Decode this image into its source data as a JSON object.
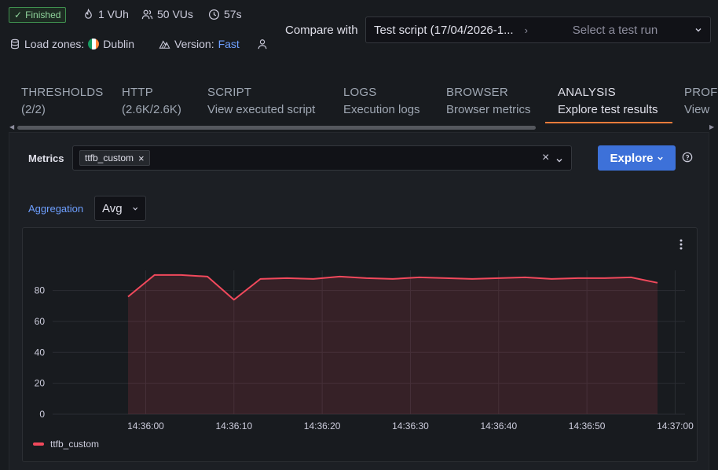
{
  "header": {
    "status_badge": "Finished",
    "vuh": "1 VUh",
    "vus": "50 VUs",
    "duration": "57s",
    "load_zones_label": "Load zones:",
    "load_zone": "Dublin",
    "version_label": "Version:",
    "version_value": "Fast",
    "compare_label": "Compare with",
    "compare_value": "Test script (17/04/2026-1...",
    "compare_placeholder": "Select a test run"
  },
  "tabs": [
    {
      "label": "THRESHOLDS",
      "sub": "(2/2)"
    },
    {
      "label": "HTTP",
      "sub": "(2.6K/2.6K)"
    },
    {
      "label": "SCRIPT",
      "sub": "View executed script"
    },
    {
      "label": "LOGS",
      "sub": "Execution logs"
    },
    {
      "label": "BROWSER",
      "sub": "Browser metrics"
    },
    {
      "label": "ANALYSIS",
      "sub": "Explore test results"
    },
    {
      "label": "PROF",
      "sub": "View"
    }
  ],
  "explore": {
    "metrics_label": "Metrics",
    "metric_chip": "ttfb_custom",
    "explore_button": "Explore",
    "aggregation_label": "Aggregation",
    "aggregation_value": "Avg"
  },
  "colors": {
    "accent": "#3d71d9",
    "series": "#f2495c",
    "tab_active": "#f17c3b",
    "finished": "#8fd39b"
  },
  "chart_data": {
    "type": "area",
    "x": [
      "14:35:58",
      "14:36:01",
      "14:36:04",
      "14:36:07",
      "14:36:10",
      "14:36:13",
      "14:36:16",
      "14:36:19",
      "14:36:22",
      "14:36:25",
      "14:36:28",
      "14:36:31",
      "14:36:34",
      "14:36:37",
      "14:36:40",
      "14:36:43",
      "14:36:46",
      "14:36:49",
      "14:36:52",
      "14:36:55",
      "14:36:58"
    ],
    "series": [
      {
        "name": "ttfb_custom",
        "values": [
          76,
          90,
          90,
          89,
          74,
          87.5,
          88,
          87.5,
          89,
          88,
          87.5,
          88.5,
          88,
          87.5,
          88,
          88.5,
          87.5,
          88,
          88,
          88.5,
          85
        ]
      }
    ],
    "xticks": [
      "14:36:00",
      "14:36:10",
      "14:36:20",
      "14:36:30",
      "14:36:40",
      "14:36:50",
      "14:37:00"
    ],
    "yticks": [
      "0",
      "20",
      "40",
      "60",
      "80"
    ],
    "ylim": [
      0,
      92
    ],
    "xlim_seconds": [
      -10,
      62
    ],
    "legend": "bottom-left",
    "grid": true
  }
}
